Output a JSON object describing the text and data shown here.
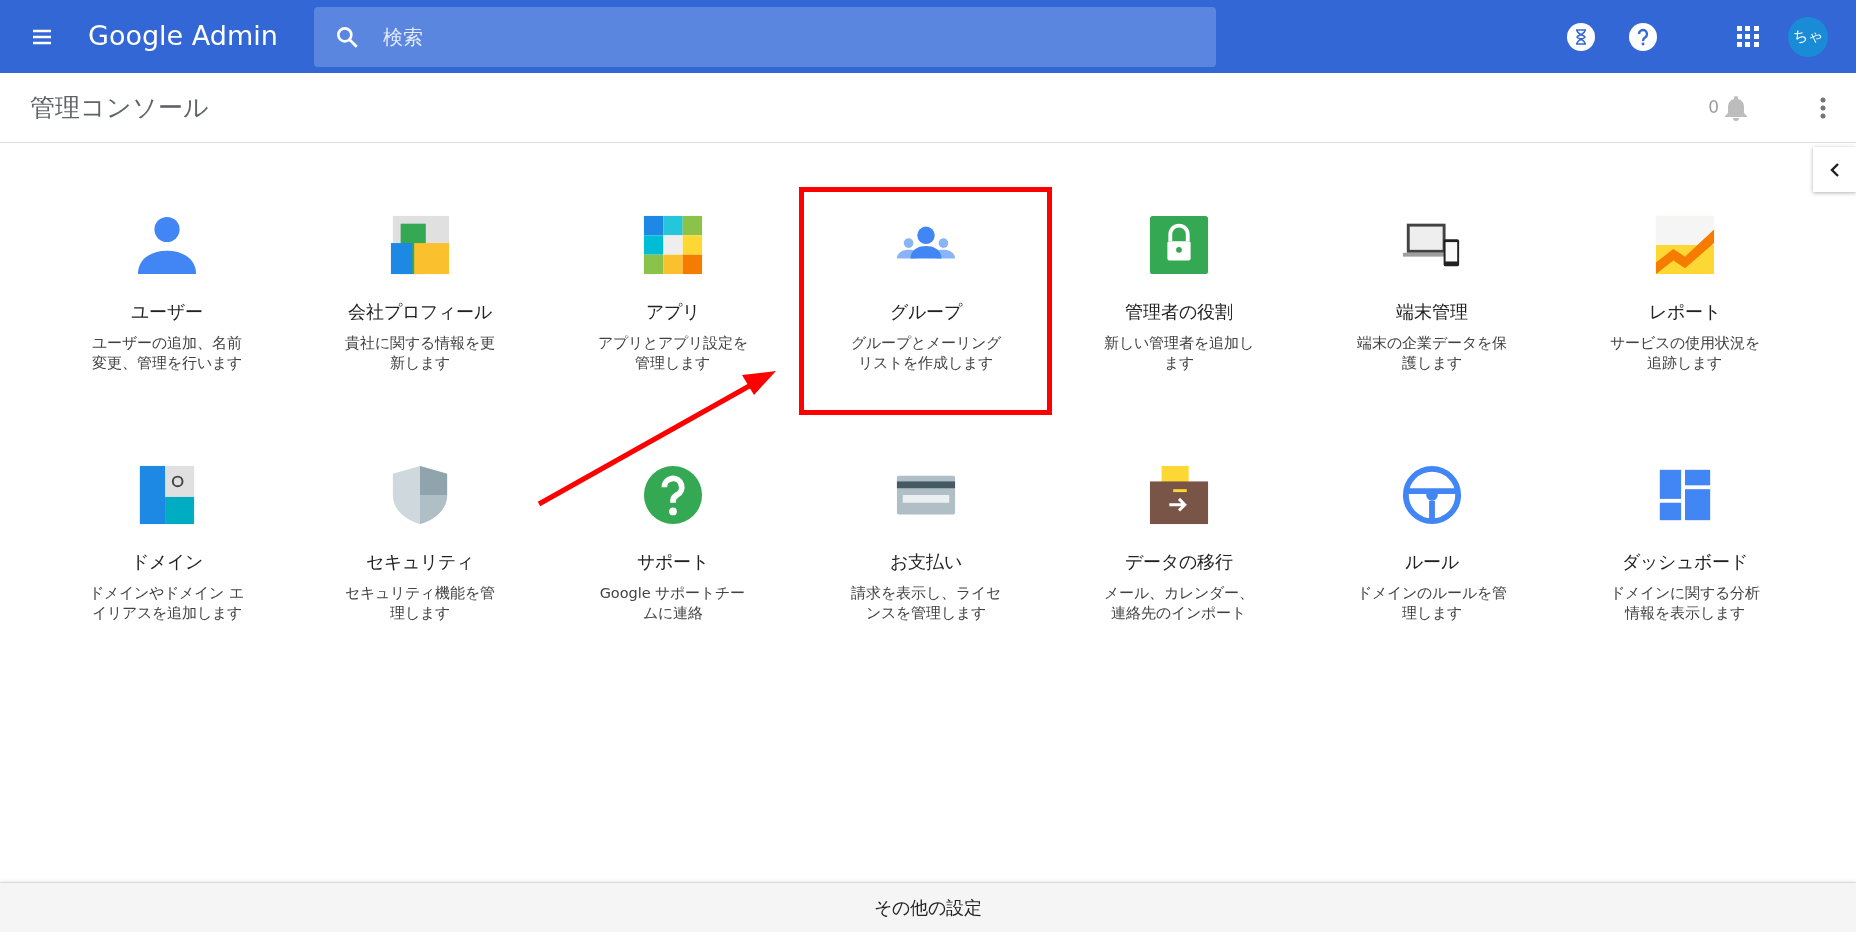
{
  "header": {
    "logo": "Google Admin",
    "search": {
      "placeholder": "検索"
    },
    "avatar": "ちゃ"
  },
  "subheader": {
    "title": "管理コンソール",
    "notification_count": "0"
  },
  "tiles": [
    {
      "title": "ユーザー",
      "description": "ユーザーの追加、名前変更、管理を行います",
      "highlighted": false
    },
    {
      "title": "会社プロフィール",
      "description": "貴社に関する情報を更新します",
      "highlighted": false
    },
    {
      "title": "アプリ",
      "description": "アプリとアプリ設定を管理します",
      "highlighted": false
    },
    {
      "title": "グループ",
      "description": "グループとメーリングリストを作成します",
      "highlighted": true
    },
    {
      "title": "管理者の役割",
      "description": "新しい管理者を追加します",
      "highlighted": false
    },
    {
      "title": "端末管理",
      "description": "端末の企業データを保護します",
      "highlighted": false
    },
    {
      "title": "レポート",
      "description": "サービスの使用状況を追跡します",
      "highlighted": false
    },
    {
      "title": "ドメイン",
      "description": "ドメインやドメイン エイリアスを追加します",
      "highlighted": false
    },
    {
      "title": "セキュリティ",
      "description": "セキュリティ機能を管理します",
      "highlighted": false
    },
    {
      "title": "サポート",
      "description": "Google サポートチームに連絡",
      "highlighted": false
    },
    {
      "title": "お支払い",
      "description": "請求を表示し、ライセンスを管理します",
      "highlighted": false
    },
    {
      "title": "データの移行",
      "description": "メール、カレンダー、連絡先のインポート",
      "highlighted": false
    },
    {
      "title": "ルール",
      "description": "ドメインのルールを管理します",
      "highlighted": false
    },
    {
      "title": "ダッシュボード",
      "description": "ドメインに関する分析情報を表示します",
      "highlighted": false
    }
  ],
  "footer": {
    "label": "その他の設定"
  }
}
